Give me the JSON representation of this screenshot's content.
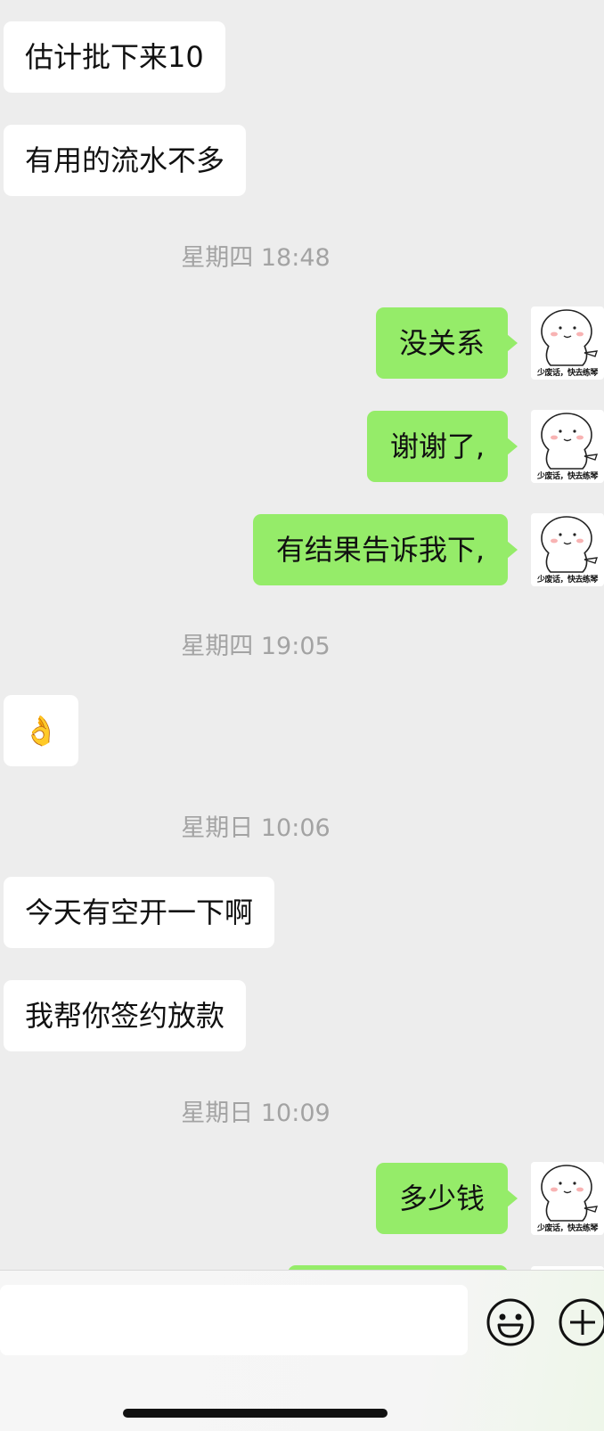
{
  "messages": [
    {
      "side": "in",
      "text": "估计批下来10"
    },
    {
      "side": "in",
      "text": "有用的流水不多"
    },
    {
      "side": "out",
      "text": "没关系"
    },
    {
      "side": "out",
      "text": "谢谢了,"
    },
    {
      "side": "out",
      "text": "有结果告诉我下,"
    },
    {
      "side": "in",
      "text": "👌"
    },
    {
      "side": "in",
      "text": "今天有空开一下啊"
    },
    {
      "side": "in",
      "text": "我帮你签约放款"
    },
    {
      "side": "out",
      "text": "多少钱"
    }
  ],
  "timestamps": [
    "星期四 18:48",
    "星期四 19:05",
    "星期日 10:06",
    "星期日 10:09"
  ],
  "avatar": {
    "caption": "少废话，快去练琴",
    "icon": "meme-sticker-avatar"
  },
  "input_bar": {
    "placeholder": "",
    "emoji_icon": "smiley-face-icon",
    "add_icon": "plus-circle-icon"
  },
  "colors": {
    "background": "#ededed",
    "incoming_bubble": "#ffffff",
    "outgoing_bubble": "#95ec69",
    "timestamp_text": "#a3a3a3"
  }
}
